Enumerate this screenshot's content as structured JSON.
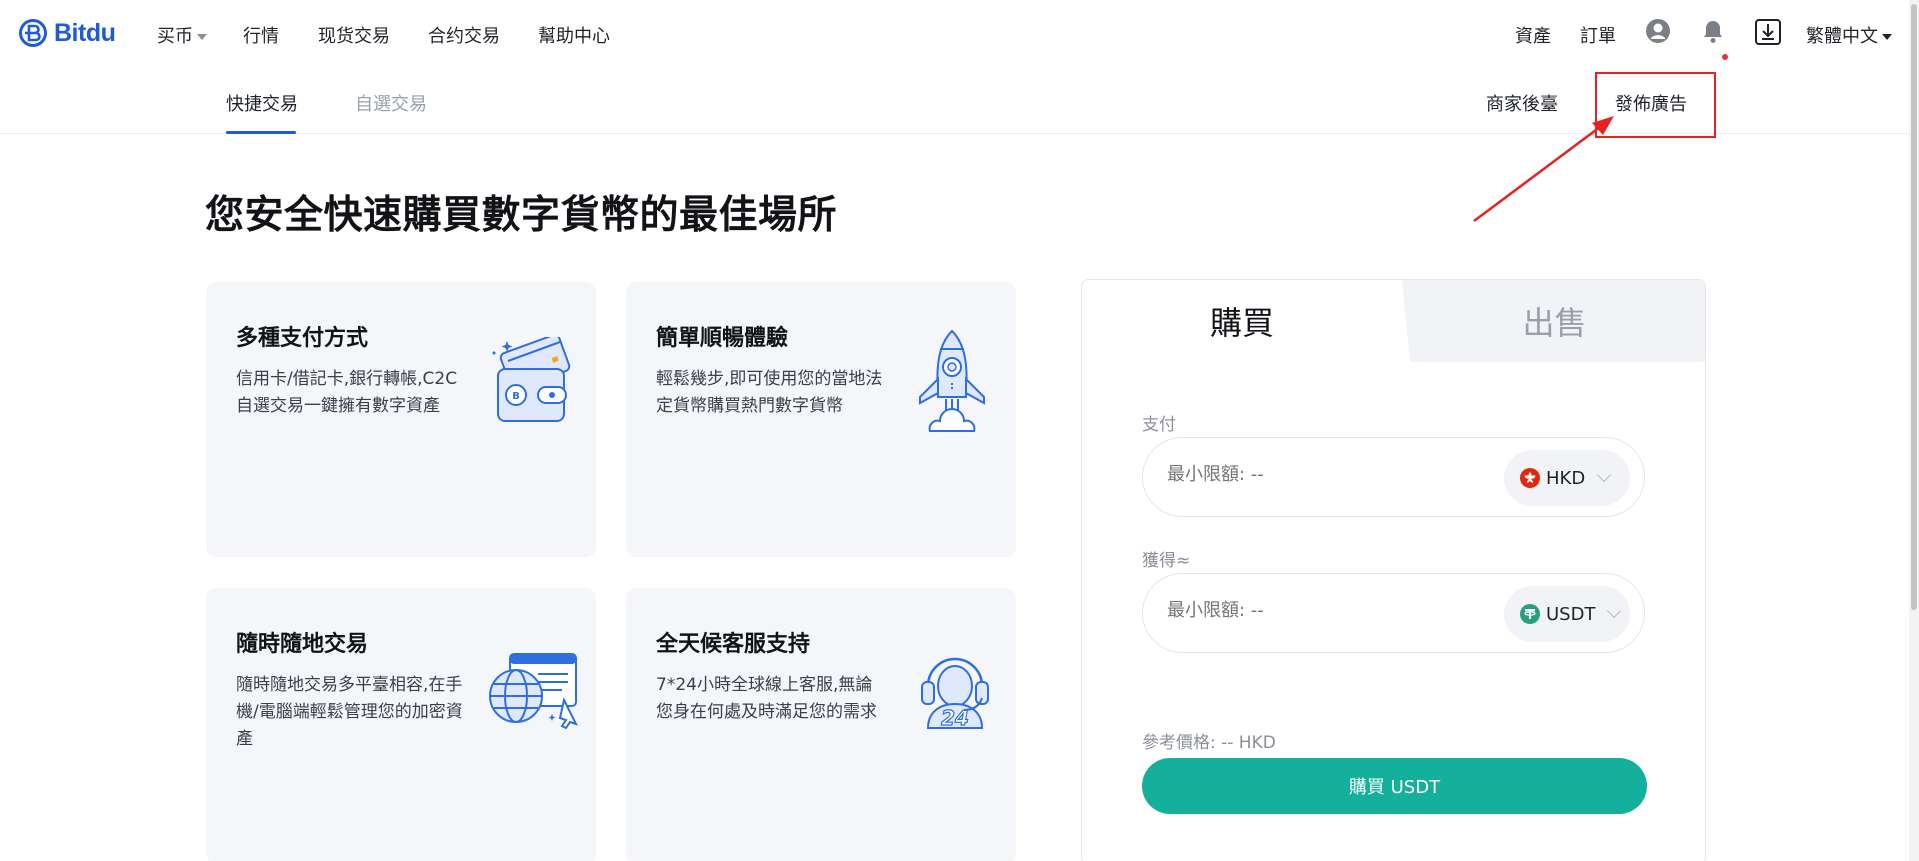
{
  "brand": {
    "name": "Bitdu",
    "color": "#1e5bd8"
  },
  "nav": {
    "items": [
      {
        "label": "买币",
        "has_dropdown": true
      },
      {
        "label": "行情"
      },
      {
        "label": "现货交易"
      },
      {
        "label": "合约交易"
      },
      {
        "label": "幫助中心"
      }
    ],
    "right": {
      "assets": "資產",
      "orders": "訂單",
      "language": "繁體中文"
    },
    "icons": [
      "user-avatar-icon",
      "bell-icon",
      "download-icon"
    ]
  },
  "subtabs": {
    "quick": "快捷交易",
    "custom": "自選交易",
    "merchant": "商家後臺",
    "post_ad": "發佈廣告"
  },
  "hero": {
    "title": "您安全快速購買數字貨幣的最佳場所"
  },
  "features": [
    {
      "title": "多種支付方式",
      "desc": "信用卡/借記卡,銀行轉帳,C2C自選交易一鍵擁有數字資產",
      "icon": "wallet-icon"
    },
    {
      "title": "簡單順暢體驗",
      "desc": "輕鬆幾步,即可使用您的當地法定貨幣購買熱門數字貨幣",
      "icon": "rocket-icon"
    },
    {
      "title": "隨時隨地交易",
      "desc": "隨時隨地交易多平臺相容,在手機/電腦端輕鬆管理您的加密資產",
      "icon": "globe-browser-icon"
    },
    {
      "title": "全天候客服支持",
      "desc": "7*24小時全球線上客服,無論您身在何處及時滿足您的需求",
      "icon": "headset-24-icon"
    }
  ],
  "trade": {
    "tab_buy": "購買",
    "tab_sell": "出售",
    "pay_label": "支付",
    "pay_placeholder": "最小限額: --",
    "pay_currency": "HKD",
    "receive_label": "獲得≈",
    "receive_placeholder": "最小限額: --",
    "receive_currency": "USDT",
    "ref_price": "參考價格:  -- HKD",
    "buy_button": "購買 USDT"
  },
  "colors": {
    "accent_green": "#14b09b",
    "annotation_red": "#e52222",
    "hkd_flag": "#de2910",
    "usdt": "#26a17b"
  }
}
